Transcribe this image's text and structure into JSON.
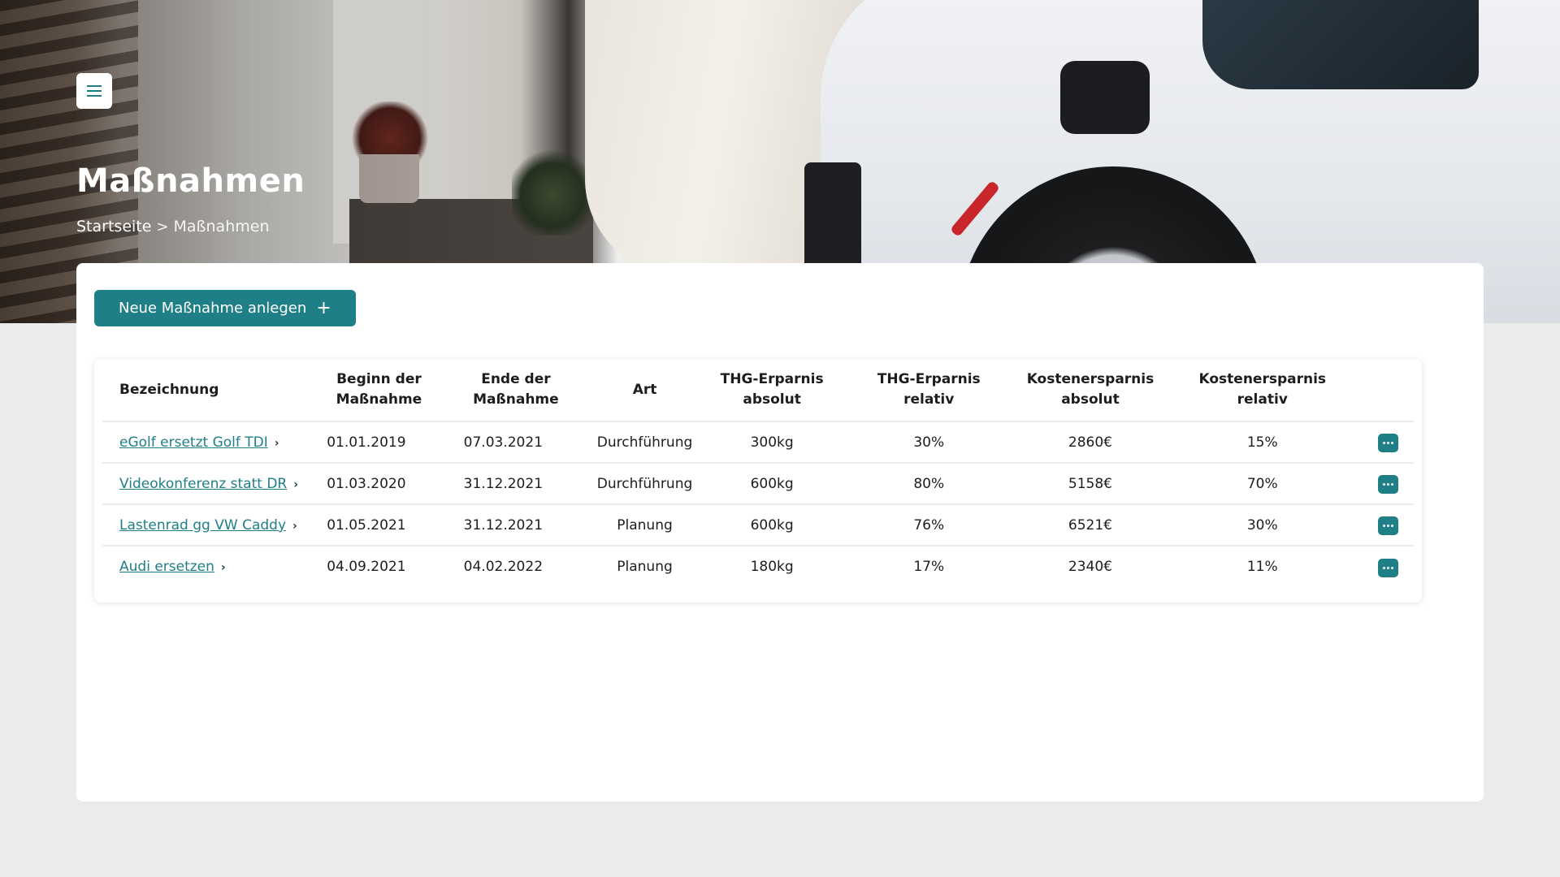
{
  "header": {
    "title": "Maßnahmen",
    "menu_icon": "hamburger-icon",
    "breadcrumb": {
      "home": "Startseite",
      "separator": ">",
      "current": "Maßnahmen"
    }
  },
  "toolbar": {
    "new_label": "Neue Maßnahme anlegen",
    "new_icon": "+"
  },
  "colors": {
    "accent": "#1f7f86",
    "background": "#ebebeb",
    "card": "#ffffff"
  },
  "table": {
    "columns": [
      {
        "line1": "Bezeichnung",
        "line2": ""
      },
      {
        "line1": "Beginn der",
        "line2": "Maßnahme"
      },
      {
        "line1": "Ende der",
        "line2": "Maßnahme"
      },
      {
        "line1": "Art",
        "line2": ""
      },
      {
        "line1": "THG-Erparnis",
        "line2": "absolut"
      },
      {
        "line1": "THG-Erparnis",
        "line2": "relativ"
      },
      {
        "line1": "Kostenersparnis",
        "line2": "absolut"
      },
      {
        "line1": "Kostenersparnis",
        "line2": "relativ"
      }
    ],
    "rows": [
      {
        "name": "eGolf ersetzt Golf TDI",
        "start": "01.01.2019",
        "end": "07.03.2021",
        "type": "Durchführung",
        "thg_abs": "300kg",
        "thg_rel": "30%",
        "cost_abs": "2860€",
        "cost_rel": "15%"
      },
      {
        "name": "Videokonferenz statt DR",
        "start": "01.03.2020",
        "end": "31.12.2021",
        "type": "Durchführung",
        "thg_abs": "600kg",
        "thg_rel": "80%",
        "cost_abs": "5158€",
        "cost_rel": "70%"
      },
      {
        "name": "Lastenrad gg VW Caddy",
        "start": "01.05.2021",
        "end": "31.12.2021",
        "type": "Planung",
        "thg_abs": "600kg",
        "thg_rel": "76%",
        "cost_abs": "6521€",
        "cost_rel": "30%"
      },
      {
        "name": "Audi ersetzen",
        "start": "04.09.2021",
        "end": "04.02.2022",
        "type": "Planung",
        "thg_abs": "180kg",
        "thg_rel": "17%",
        "cost_abs": "2340€",
        "cost_rel": "11%"
      }
    ]
  }
}
